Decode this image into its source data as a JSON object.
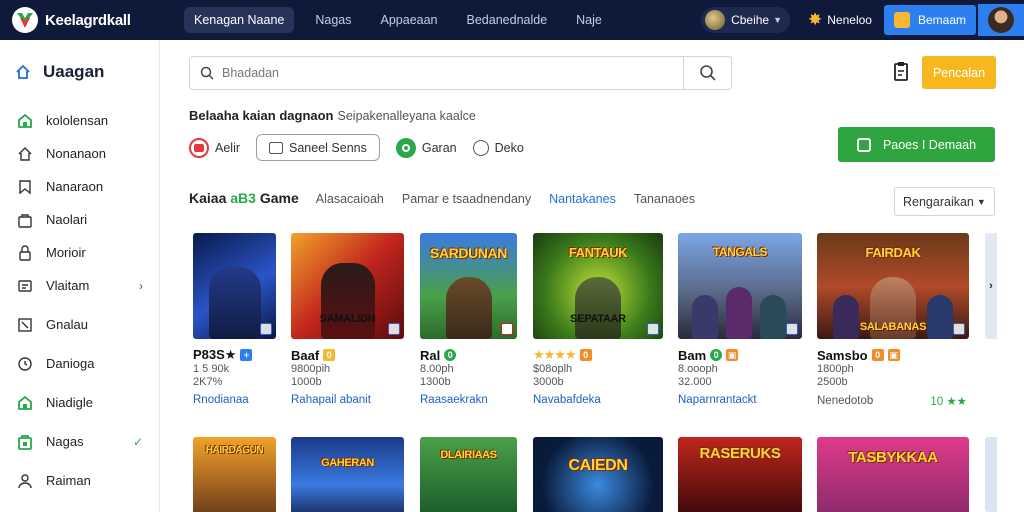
{
  "brand": {
    "name": "Keelagrdkall"
  },
  "nav": [
    {
      "label": "Kenagan Naane",
      "active": true
    },
    {
      "label": "Nagas",
      "active": false
    },
    {
      "label": "Appaeaan",
      "active": false
    },
    {
      "label": "Bedanednalde",
      "active": false
    },
    {
      "label": "Naje",
      "active": false
    }
  ],
  "top_right": {
    "coin_label": "Cbeihe",
    "star_label": "Neneloo",
    "user_button": "Bemaam"
  },
  "sidebar": {
    "header": "Uaagan",
    "items": [
      {
        "label": "kololensan",
        "icon": "home-green-icon",
        "tail": ""
      },
      {
        "label": "Nonanaon",
        "icon": "home-icon",
        "tail": ""
      },
      {
        "label": "Nanaraon",
        "icon": "bookmark-icon",
        "tail": ""
      },
      {
        "label": "Naolari",
        "icon": "bag-icon",
        "tail": ""
      },
      {
        "label": "Morioir",
        "icon": "lock-icon",
        "tail": ""
      },
      {
        "label": "Vlaitam",
        "icon": "cart-icon",
        "tail": "›"
      },
      {
        "label": "Gnalau",
        "icon": "edit-icon",
        "tail": ""
      },
      {
        "label": "Danioga",
        "icon": "clock-icon",
        "tail": ""
      },
      {
        "label": "Niadigle",
        "icon": "home-green-icon",
        "tail": ""
      },
      {
        "label": "Nagas",
        "icon": "bag-green-icon",
        "tail": "✓"
      },
      {
        "label": "Raiman",
        "icon": "user-icon",
        "tail": ""
      }
    ]
  },
  "search": {
    "placeholder": "Bhadadan"
  },
  "primary_button": "Pencalan",
  "headline": {
    "main": "Belaaha kaian dagnaon",
    "sub": "Seipakenalleyana kaalce"
  },
  "filters": [
    {
      "label": "Aelir",
      "icon": "red-badge-icon",
      "outlined": false
    },
    {
      "label": "Saneel Senns",
      "icon": "box-icon",
      "outlined": true
    },
    {
      "label": "Garan",
      "icon": "green-circle-icon",
      "outlined": false
    },
    {
      "label": "Deko",
      "icon": "clock-icon",
      "outlined": false
    }
  ],
  "green_button": "Paoes I Demaah",
  "section": {
    "title_prefix": "Kaiaa",
    "title_count": "aB3",
    "title_suffix": "Game",
    "tabs": [
      {
        "label": "Alasacaioah",
        "active": false
      },
      {
        "label": "Pamar e tsaadnendany",
        "active": false
      },
      {
        "label": "Nantakanes",
        "active": true
      },
      {
        "label": "Tananaoes",
        "active": false
      }
    ],
    "sort": "Rengaraikan"
  },
  "games": [
    {
      "thumb_title": "",
      "thumb_sub": "",
      "name": "P83S★",
      "badge_color": "#2d7ff0",
      "badge": "+",
      "line1": "1 5 90k",
      "line2": "2K7%",
      "link": "Rnodianaa",
      "link_muted": false,
      "stars": ""
    },
    {
      "thumb_title": "",
      "thumb_sub": "SAMALIDH",
      "name": "Baaf",
      "badge_color": "#f5b82e",
      "badge": "0",
      "line1": "9800pih",
      "line2": "1000b",
      "link": "Rahapail abanit",
      "link_muted": false,
      "stars": ""
    },
    {
      "thumb_title": "SARDUNAN",
      "thumb_sub": "",
      "name": "Ral",
      "badge_color": "#2aa84a",
      "badge": "0",
      "line1": "8.00ph",
      "line2": "1300b",
      "link": "Raasaekrakn",
      "link_muted": false,
      "stars": ""
    },
    {
      "thumb_title": "FANTAUK",
      "thumb_sub": "SEPATAAR",
      "name": "",
      "badge_color": "#f28c28",
      "badge": "0",
      "line1": "$08oplh",
      "line2": "3000b",
      "link": "Navabafdeka",
      "link_muted": false,
      "stars": "★★★★"
    },
    {
      "thumb_title": "TANGALS",
      "thumb_sub": "",
      "name": "Bam",
      "badge_color": "#2aa84a",
      "badge": "0",
      "line1": "8.oooph",
      "line2": "32.000",
      "link": "Naparnrantackt",
      "link_muted": false,
      "stars": ""
    },
    {
      "thumb_title": "FAIRDAK",
      "thumb_sub": "SALABANAS",
      "name": "Samsbo",
      "badge_color": "#f28c28",
      "badge": "0",
      "line1": "1800ph",
      "line2": "2500b",
      "link": "Nenedotob",
      "link_muted": true,
      "stars": ""
    }
  ],
  "games_row2": [
    {
      "thumb_title": "HAIRDAGUN"
    },
    {
      "thumb_title": "GAHERAN"
    },
    {
      "thumb_title": "DLAIRIAAS"
    },
    {
      "thumb_title": "CAIEDN"
    },
    {
      "thumb_title": "RASERUKS"
    },
    {
      "thumb_title": "TASBYKKAA"
    }
  ],
  "extra_rating": "10 ★★"
}
